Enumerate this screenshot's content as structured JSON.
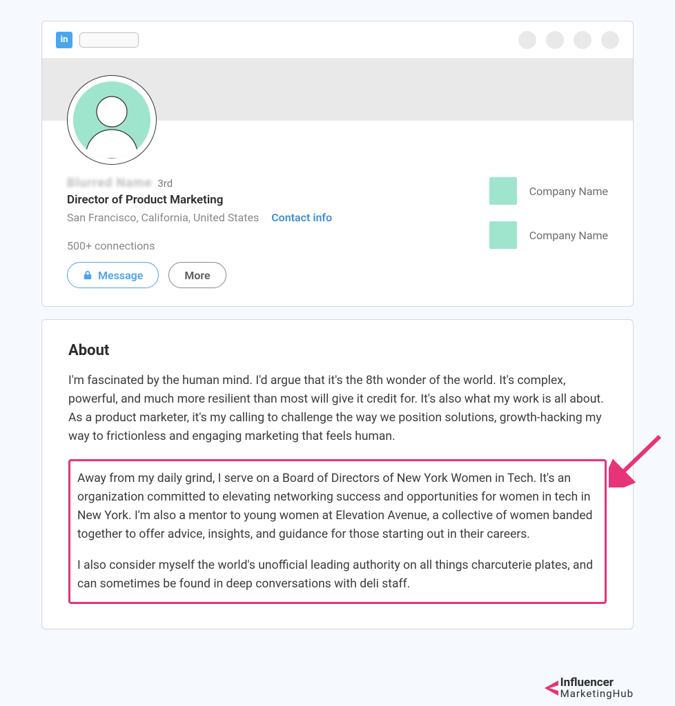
{
  "header": {
    "logo_text": "in"
  },
  "profile": {
    "name": "Blurred Name",
    "degree": "3rd",
    "headline": "Director of Product Marketing",
    "location": "San Francisco, California, United States",
    "contact_info": "Contact info",
    "connections": "500+ connections",
    "message_btn": "Message",
    "more_btn": "More",
    "companies": [
      {
        "name": "Company Name"
      },
      {
        "name": "Company Name"
      }
    ]
  },
  "about": {
    "title": "About",
    "p1": "I'm fascinated by the human mind. I'd argue that it's the 8th wonder of the world. It's complex, powerful, and much more resilient than most will give it credit for. It's also what my work is all about. As a product marketer, it's my calling to challenge the way we position solutions, growth-hacking my way to frictionless and engaging marketing that feels human.",
    "p2": "Away from my daily grind, I serve on a Board of Directors of New York Women in Tech. It's an organization committed to elevating networking success and opportunities for women in tech in New York. I'm also a mentor to young women at Elevation Avenue, a collective of women banded together to offer advice, insights, and guidance for those starting out in their careers.",
    "p3": "I also consider myself the world's unofficial leading authority on all things charcuterie plates, and can sometimes be found in deep conversations with deli staff."
  },
  "footer": {
    "brand1": "Influencer",
    "brand2": "MarketingHub"
  }
}
